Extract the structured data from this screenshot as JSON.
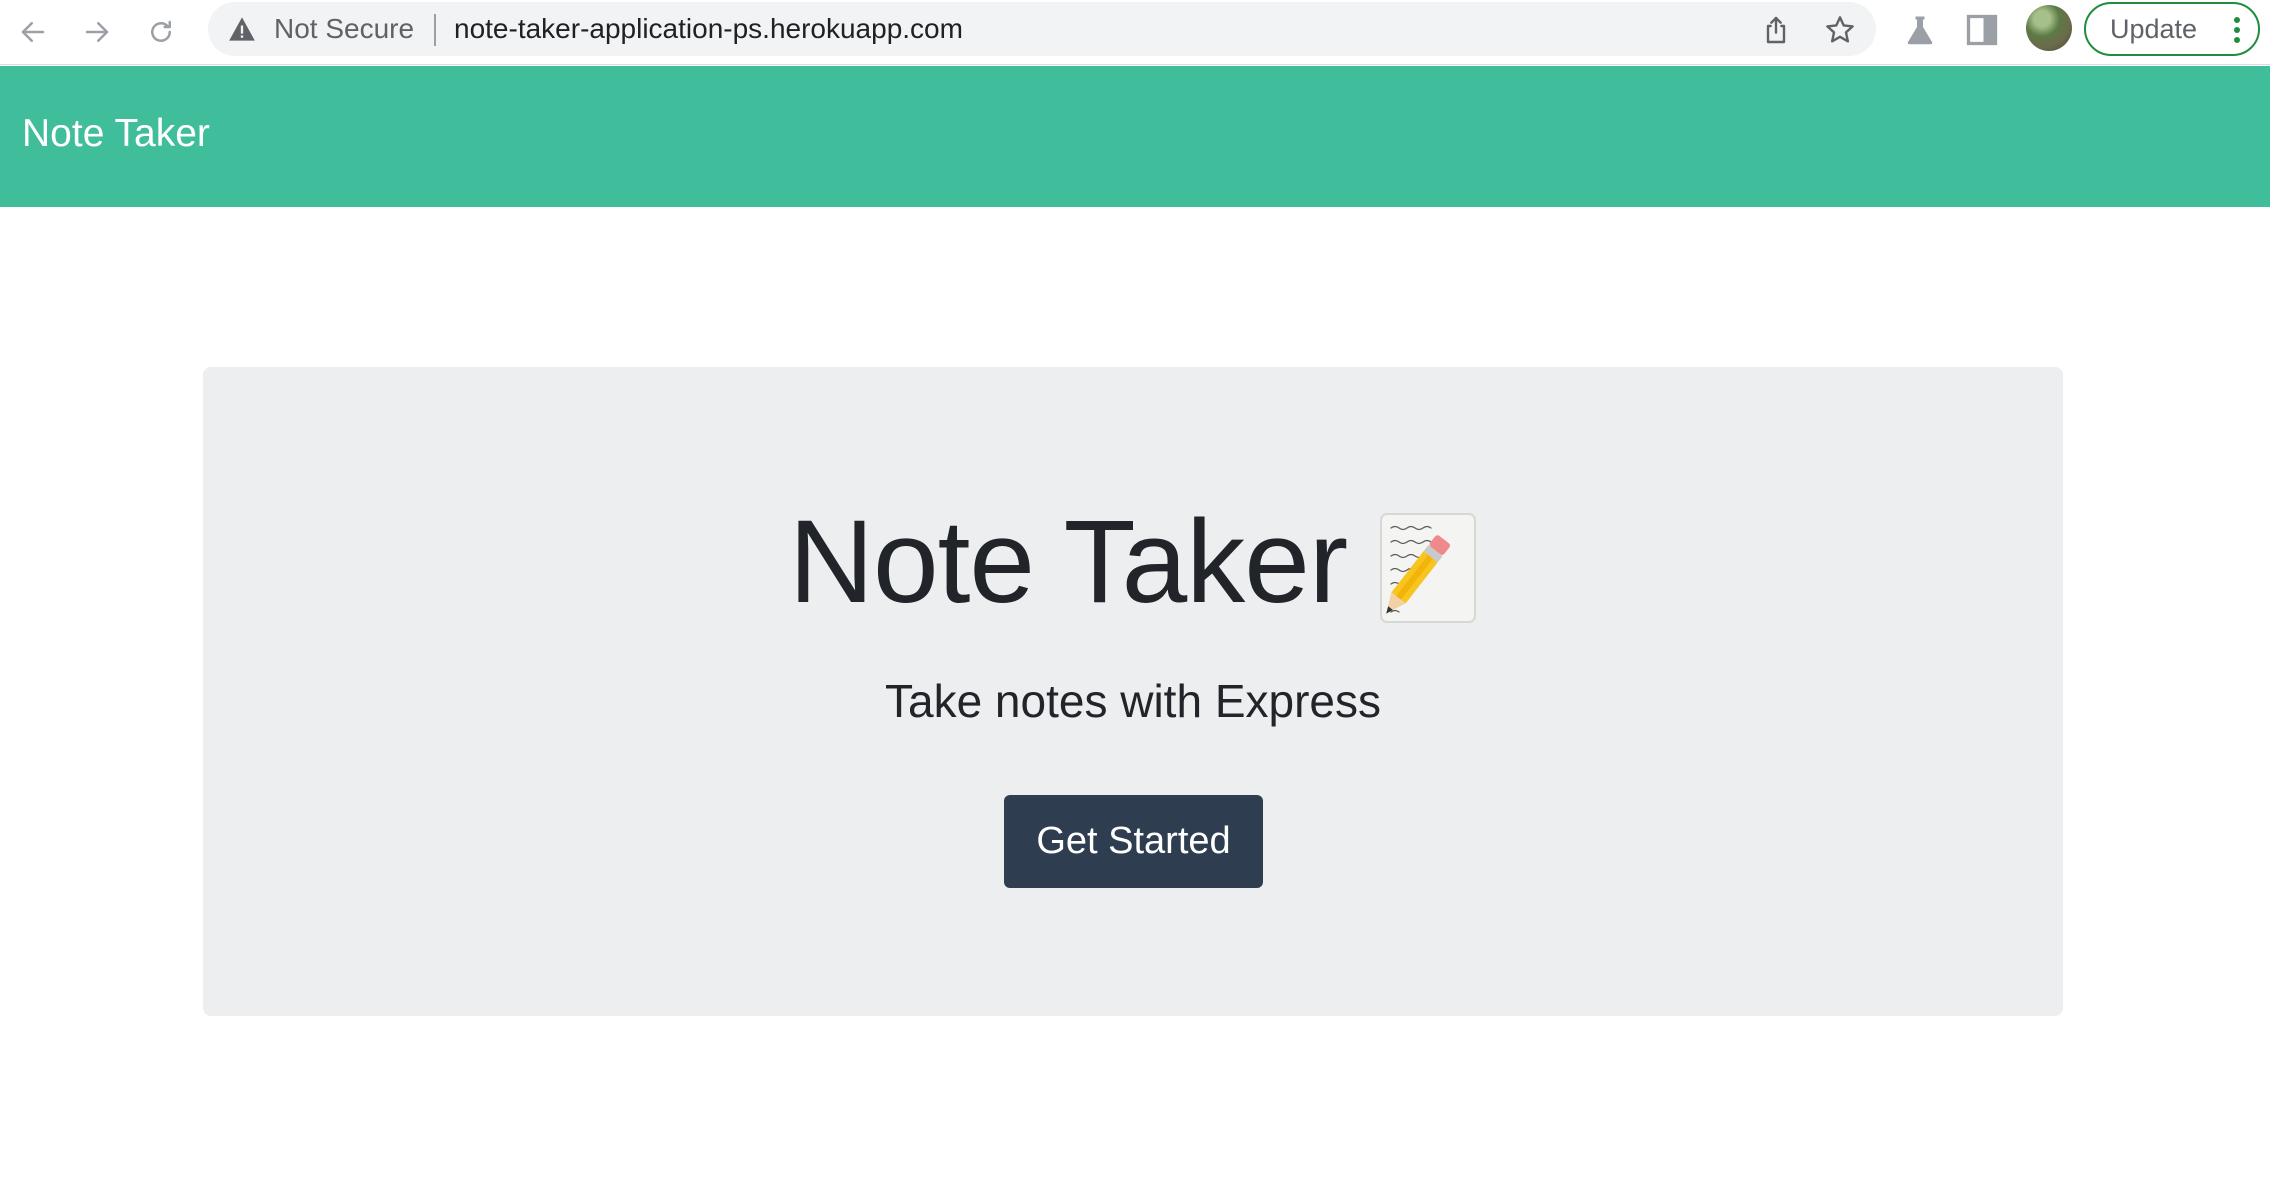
{
  "browser": {
    "security_label": "Not Secure",
    "url": "note-taker-application-ps.herokuapp.com",
    "update_label": "Update",
    "icons": {
      "back": "arrow-left-icon",
      "forward": "arrow-right-icon",
      "reload": "reload-icon",
      "warning": "warning-triangle-icon",
      "share": "share-icon",
      "bookmark": "star-icon",
      "labs": "flask-icon",
      "side_panel": "side-panel-icon",
      "menu": "kebab-menu-icon"
    },
    "colors": {
      "update_border": "#1e8e3e",
      "omnibox_bg": "#f1f3f4"
    }
  },
  "navbar": {
    "brand": "Note Taker",
    "background": "#40bd9a"
  },
  "hero": {
    "title": "Note Taker",
    "title_icon": "memo-icon",
    "subtitle": "Take notes with Express",
    "button_label": "Get Started",
    "button_color": "#2e3e50",
    "panel_color": "#eceef0"
  }
}
